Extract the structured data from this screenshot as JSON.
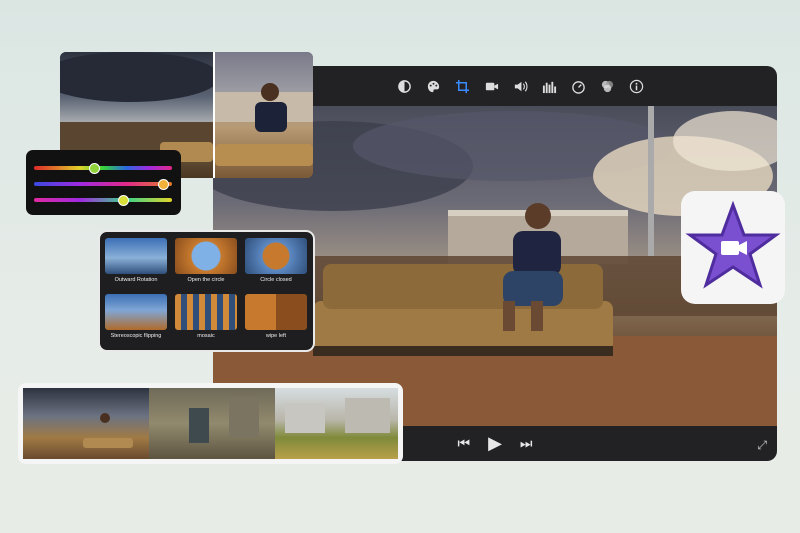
{
  "editor": {
    "toolbar": [
      {
        "name": "color-balance-icon"
      },
      {
        "name": "color-palette-icon"
      },
      {
        "name": "crop-icon",
        "active": true
      },
      {
        "name": "stabilization-camera-icon"
      },
      {
        "name": "volume-icon"
      },
      {
        "name": "equalizer-icon"
      },
      {
        "name": "speed-gauge-icon"
      },
      {
        "name": "filter-overlay-icon"
      },
      {
        "name": "info-icon"
      }
    ],
    "playback": {
      "previous": "⏮",
      "play": "▶",
      "next": "⏭",
      "expand": "⤢"
    },
    "accent_color": "#3a8bff"
  },
  "transitions": {
    "items": [
      {
        "label": "Outward Rotation"
      },
      {
        "label": "Open the circle"
      },
      {
        "label": "Circle closed"
      },
      {
        "label": "Stereoscopic flipping"
      },
      {
        "label": "mosaic"
      },
      {
        "label": "wipe left"
      }
    ]
  },
  "sliders": {
    "values": [
      0.4,
      0.9,
      0.6
    ]
  },
  "app_icon": {
    "name": "imovie-star-icon",
    "color": "#7a4fd0"
  }
}
